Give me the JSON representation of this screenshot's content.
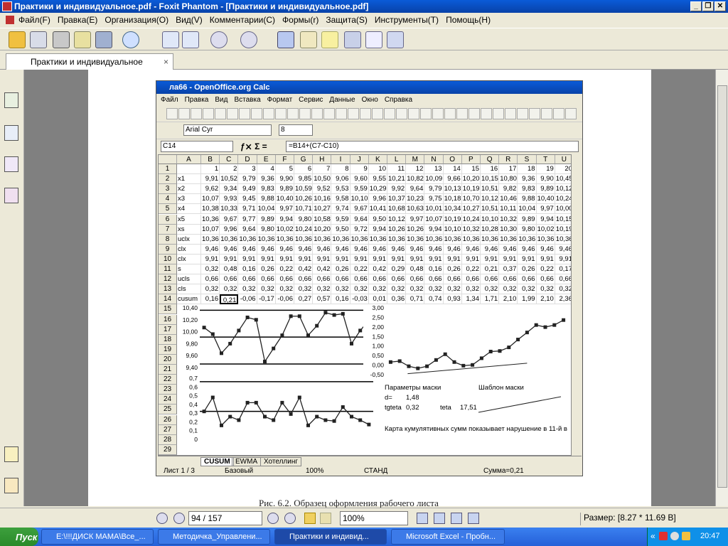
{
  "window": {
    "title": "Практики и индивидуальное.pdf - Foxit Phantom - [Практики и индивидуальное.pdf]",
    "minimize": "_",
    "restore": "❐",
    "close": "✕"
  },
  "menu": [
    "Файл(F)",
    "Правка(E)",
    "Организация(O)",
    "Вид(V)",
    "Комментарии(C)",
    "Формы(r)",
    "Защита(S)",
    "Инструменты(T)",
    "Помощь(H)"
  ],
  "tab": {
    "label": "Практики и индивидуальное",
    "close": "×"
  },
  "calc": {
    "title": "ла66 - OpenOffice.org Calc",
    "menu": [
      "Файл",
      "Правка",
      "Вид",
      "Вставка",
      "Формат",
      "Сервис",
      "Данные",
      "Окно",
      "Справка"
    ],
    "font": "Arial Cyr",
    "size": "8",
    "cellref": "C14",
    "formula": "=B14+(C7-C10)",
    "columns": [
      "A",
      "B",
      "C",
      "D",
      "E",
      "F",
      "G",
      "H",
      "I",
      "J",
      "K",
      "L",
      "M",
      "N",
      "O",
      "P",
      "Q",
      "R",
      "S",
      "T",
      "U"
    ],
    "rows": [
      {
        "n": "1",
        "a": "",
        "v": [
          "1",
          "2",
          "3",
          "4",
          "5",
          "6",
          "7",
          "8",
          "9",
          "10",
          "11",
          "12",
          "13",
          "14",
          "15",
          "16",
          "17",
          "18",
          "19",
          "20"
        ]
      },
      {
        "n": "2",
        "a": "x1",
        "v": [
          "9,91",
          "10,52",
          "9,79",
          "9,36",
          "9,90",
          "9,85",
          "10,50",
          "9,06",
          "9,60",
          "9,55",
          "10,21",
          "10,82",
          "10,09",
          "9,66",
          "10,20",
          "10,15",
          "10,80",
          "9,36",
          "9,90",
          "10,45"
        ]
      },
      {
        "n": "3",
        "a": "x2",
        "v": [
          "9,62",
          "9,34",
          "9,49",
          "9,83",
          "9,89",
          "10,59",
          "9,52",
          "9,53",
          "9,59",
          "10,29",
          "9,92",
          "9,64",
          "9,79",
          "10,13",
          "10,19",
          "10,51",
          "9,82",
          "9,83",
          "9,89",
          "10,12"
        ]
      },
      {
        "n": "4",
        "a": "x3",
        "v": [
          "10,07",
          "9,93",
          "9,45",
          "9,88",
          "10,40",
          "10,26",
          "10,16",
          "9,58",
          "10,10",
          "9,96",
          "10,37",
          "10,23",
          "9,75",
          "10,18",
          "10,70",
          "10,12",
          "10,46",
          "9,88",
          "10,40",
          "10,24"
        ]
      },
      {
        "n": "5",
        "a": "x4",
        "v": [
          "10,38",
          "10,33",
          "9,71",
          "10,04",
          "9,97",
          "10,71",
          "10,27",
          "9,74",
          "9,67",
          "10,41",
          "10,68",
          "10,63",
          "10,01",
          "10,34",
          "10,27",
          "10,51",
          "10,11",
          "10,04",
          "9,97",
          "10,00"
        ]
      },
      {
        "n": "6",
        "a": "x5",
        "v": [
          "10,36",
          "9,67",
          "9,77",
          "9,89",
          "9,94",
          "9,80",
          "10,58",
          "9,59",
          "9,64",
          "9,50",
          "10,12",
          "9,97",
          "10,07",
          "10,19",
          "10,24",
          "10,10",
          "10,32",
          "9,89",
          "9,94",
          "10,15"
        ]
      },
      {
        "n": "7",
        "a": "xs",
        "v": [
          "10,07",
          "9,96",
          "9,64",
          "9,80",
          "10,02",
          "10,24",
          "10,20",
          "9,50",
          "9,72",
          "9,94",
          "10,26",
          "10,26",
          "9,94",
          "10,10",
          "10,32",
          "10,28",
          "10,30",
          "9,80",
          "10,02",
          "10,19"
        ]
      },
      {
        "n": "8",
        "a": "uclx",
        "v": [
          "10,36",
          "10,36",
          "10,36",
          "10,36",
          "10,36",
          "10,36",
          "10,36",
          "10,36",
          "10,36",
          "10,36",
          "10,36",
          "10,36",
          "10,36",
          "10,36",
          "10,36",
          "10,36",
          "10,36",
          "10,36",
          "10,36",
          "10,36"
        ]
      },
      {
        "n": "9",
        "a": "clx",
        "v": [
          "9,46",
          "9,46",
          "9,46",
          "9,46",
          "9,46",
          "9,46",
          "9,46",
          "9,46",
          "9,46",
          "9,46",
          "9,46",
          "9,46",
          "9,46",
          "9,46",
          "9,46",
          "9,46",
          "9,46",
          "9,46",
          "9,46",
          "9,46"
        ]
      },
      {
        "n": "10",
        "a": "clx",
        "v": [
          "9,91",
          "9,91",
          "9,91",
          "9,91",
          "9,91",
          "9,91",
          "9,91",
          "9,91",
          "9,91",
          "9,91",
          "9,91",
          "9,91",
          "9,91",
          "9,91",
          "9,91",
          "9,91",
          "9,91",
          "9,91",
          "9,91",
          "9,91"
        ]
      },
      {
        "n": "11",
        "a": "s",
        "v": [
          "0,32",
          "0,48",
          "0,16",
          "0,26",
          "0,22",
          "0,42",
          "0,42",
          "0,26",
          "0,22",
          "0,42",
          "0,29",
          "0,48",
          "0,16",
          "0,26",
          "0,22",
          "0,21",
          "0,37",
          "0,26",
          "0,22",
          "0,17"
        ]
      },
      {
        "n": "12",
        "a": "ucls",
        "v": [
          "0,66",
          "0,66",
          "0,66",
          "0,66",
          "0,66",
          "0,66",
          "0,66",
          "0,66",
          "0,66",
          "0,66",
          "0,66",
          "0,66",
          "0,66",
          "0,66",
          "0,66",
          "0,66",
          "0,66",
          "0,66",
          "0,66",
          "0,66"
        ]
      },
      {
        "n": "13",
        "a": "cls",
        "v": [
          "0,32",
          "0,32",
          "0,32",
          "0,32",
          "0,32",
          "0,32",
          "0,32",
          "0,32",
          "0,32",
          "0,32",
          "0,32",
          "0,32",
          "0,32",
          "0,32",
          "0,32",
          "0,32",
          "0,32",
          "0,32",
          "0,32",
          "0,32"
        ]
      },
      {
        "n": "14",
        "a": "cusum",
        "v": [
          "0,16",
          "0,21",
          "-0,06",
          "-0,17",
          "-0,06",
          "0,27",
          "0,57",
          "0,16",
          "-0,03",
          "0,01",
          "0,36",
          "0,71",
          "0,74",
          "0,93",
          "1,34",
          "1,71",
          "2,10",
          "1,99",
          "2,10",
          "2,36"
        ]
      }
    ],
    "morerows": [
      "15",
      "16",
      "17",
      "18",
      "19",
      "20",
      "21",
      "22",
      "23",
      "24",
      "25",
      "26",
      "27",
      "28",
      "29"
    ],
    "chart1": {
      "ticks": [
        "10,40",
        "10,20",
        "10,00",
        "9,80",
        "9,60",
        "9,40"
      ],
      "values": [
        10.07,
        9.96,
        9.64,
        9.8,
        10.02,
        10.24,
        10.2,
        9.5,
        9.72,
        9.94,
        10.26,
        10.26,
        9.94,
        10.1,
        10.32,
        10.28,
        10.3,
        9.8,
        10.02,
        10.19
      ],
      "ucl": 10.36,
      "cl": 9.91,
      "lcl": 9.46
    },
    "chart2": {
      "ticks": [
        "0,7",
        "0,6",
        "0,5",
        "0,4",
        "0,3",
        "0,2",
        "0,1",
        "0"
      ],
      "values": [
        0.32,
        0.48,
        0.16,
        0.26,
        0.22,
        0.42,
        0.42,
        0.26,
        0.22,
        0.42,
        0.29,
        0.48,
        0.16,
        0.26,
        0.22,
        0.21,
        0.37,
        0.26,
        0.22,
        0.17
      ],
      "ucl": 0.66,
      "cl": 0.32
    },
    "chart3": {
      "ticks": [
        "3,00",
        "2,50",
        "2,00",
        "1,50",
        "1,00",
        "0,50",
        "0,00",
        "-0,50"
      ],
      "values": [
        0.16,
        0.21,
        -0.06,
        -0.17,
        -0.06,
        0.27,
        0.57,
        0.16,
        -0.03,
        0.01,
        0.36,
        0.71,
        0.74,
        0.93,
        1.34,
        1.71,
        2.1,
        1.99,
        2.1,
        2.36
      ]
    },
    "params": {
      "title": "Параметры маски",
      "template": "Шаблон маски",
      "d_label": "d=",
      "d_val": "1,48",
      "tg_label": "tgteta",
      "tg_val": "0,32",
      "teta_label": "teta",
      "teta_val": "17,51"
    },
    "note": "Карта кумулятивных сумм показывает нарушение в 11-й в",
    "sheettabs": [
      "CUSUM",
      "EWMA",
      "Хотеллинг"
    ],
    "status": {
      "sheet": "Лист 1 / 3",
      "style": "Базовый",
      "zoom": "100%",
      "mode": "СТАНД",
      "sum": "Сумма=0,21"
    }
  },
  "caption": "Рис. 6.2. Образец оформления рабочего листа",
  "nav": {
    "page": "94 / 157",
    "zoom": "100%",
    "size": "Размер: [8.27 * 11.69 B]"
  },
  "taskbar": {
    "start": "Пуск",
    "tasks": [
      "E:\\!!!ДИСК МАМА\\Все_...",
      "Методичка_Управлени...",
      "Практики и индивид...",
      "Microsoft Excel - Пробн..."
    ],
    "time": "20:47",
    "lang": "«"
  }
}
